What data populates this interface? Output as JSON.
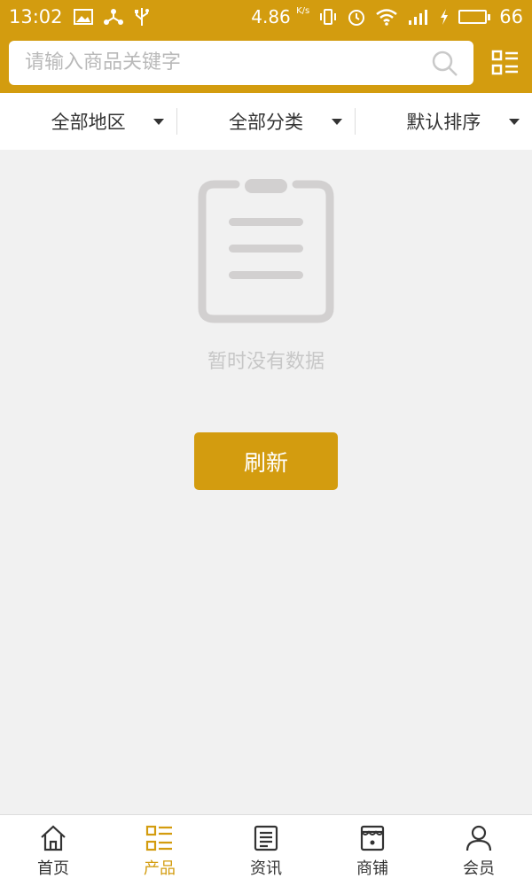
{
  "status_bar": {
    "time": "13:02",
    "speed": "4.86",
    "speed_unit": "K/s",
    "battery_level": "66",
    "battery_fraction": 0.66
  },
  "search": {
    "placeholder": "请输入商品关键字"
  },
  "filters": [
    {
      "label": "全部地区"
    },
    {
      "label": "全部分类"
    },
    {
      "label": "默认排序"
    }
  ],
  "empty_state": {
    "message": "暂时没有数据",
    "refresh_label": "刷新"
  },
  "bottom_nav": [
    {
      "label": "首页",
      "icon": "home-icon"
    },
    {
      "label": "产品",
      "icon": "product-grid-icon",
      "active": true
    },
    {
      "label": "资讯",
      "icon": "news-icon"
    },
    {
      "label": "商铺",
      "icon": "shop-icon"
    },
    {
      "label": "会员",
      "icon": "user-icon"
    }
  ],
  "colors": {
    "accent": "#d39c0f",
    "background": "#f1f1f1"
  }
}
